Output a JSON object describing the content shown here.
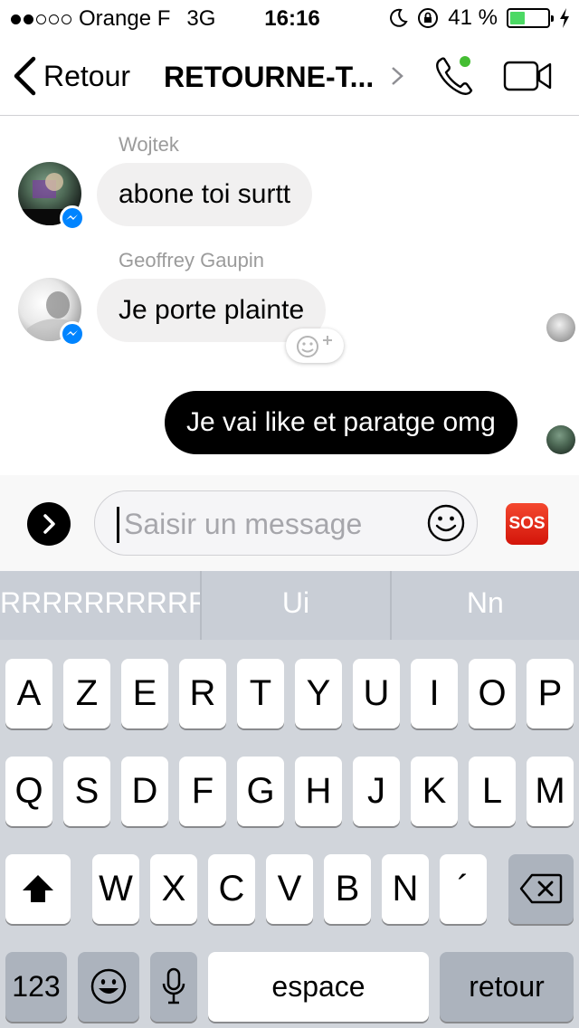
{
  "status_bar": {
    "carrier": "Orange F",
    "network": "3G",
    "time": "16:16",
    "battery": "41 %",
    "battery_level": 0.41,
    "signal_bars": 2
  },
  "nav": {
    "back_label": "Retour",
    "title": "RETOURNE-T..."
  },
  "messages": [
    {
      "sender": "Wojtek",
      "text": "abone toi surtt",
      "direction": "incoming"
    },
    {
      "sender": "Geoffrey Gaupin",
      "text": "Je porte plainte",
      "direction": "incoming"
    },
    {
      "sender": "",
      "text": "Je vai like et paratge omg",
      "direction": "outgoing"
    }
  ],
  "composer": {
    "placeholder": "Saisir un message",
    "sos_label": "SOS"
  },
  "keyboard": {
    "suggestions": [
      "RRRRRRRRRRR",
      "Ui",
      "Nn"
    ],
    "row1": [
      "A",
      "Z",
      "E",
      "R",
      "T",
      "Y",
      "U",
      "I",
      "O",
      "P"
    ],
    "row2": [
      "Q",
      "S",
      "D",
      "F",
      "G",
      "H",
      "J",
      "K",
      "L",
      "M"
    ],
    "row3": [
      "W",
      "X",
      "C",
      "V",
      "B",
      "N",
      "´"
    ],
    "numbers_label": "123",
    "space_label": "espace",
    "return_label": "retour"
  },
  "colors": {
    "messenger_blue": "#0084ff",
    "online_green": "#44bd32",
    "battery_green": "#4cd964",
    "sos_red": "#e8281a"
  }
}
